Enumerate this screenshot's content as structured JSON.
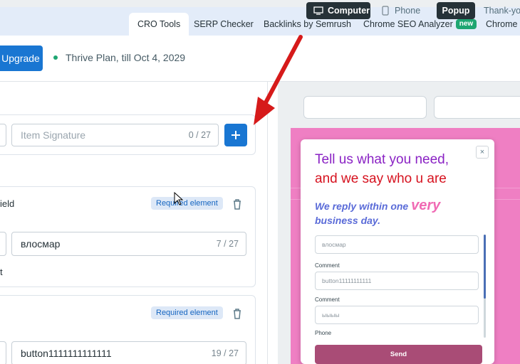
{
  "tabs": [
    {
      "label": "CRO Tools",
      "active": true
    },
    {
      "label": "SERP Checker"
    },
    {
      "label": "Backlinks by Semrush"
    },
    {
      "label": "Chrome SEO Analyzer",
      "badge": "new"
    },
    {
      "label": "Chrome U"
    }
  ],
  "plan": {
    "upgrade_label": "Upgrade",
    "text": "Thrive Plan, till Oct 4, 2029",
    "status_color": "#1ea672"
  },
  "editor": {
    "signature": {
      "placeholder": "Item Signature",
      "counter": "0 / 27"
    },
    "element1": {
      "title_fragment": "ield",
      "chip": "Required element",
      "value": "влосмар",
      "counter": "7 / 27",
      "below_fragment": "t"
    },
    "element2": {
      "chip": "Required element",
      "value": "button1111111111111",
      "counter": "19 / 27"
    }
  },
  "preview": {
    "modes": [
      {
        "label": "Computer",
        "icon": "monitor-icon",
        "active": true
      },
      {
        "label": "Phone",
        "icon": "phone-icon"
      }
    ],
    "views": [
      {
        "label": "Popup",
        "active": true
      },
      {
        "label": "Thank-yo"
      }
    ],
    "background_color": "#ef7fc3",
    "popup": {
      "close": "×",
      "heading_line1": "Tell us what you need,",
      "heading_line2": "and we say who u are",
      "sub_before": "We reply within one",
      "sub_emph": "very",
      "sub_line2": "business day.",
      "fields": [
        {
          "placeholder": "влосмар",
          "label": "Comment"
        },
        {
          "placeholder": "button11111111111",
          "label": "Comment"
        },
        {
          "placeholder": "ыыыы",
          "label": "Phone"
        }
      ],
      "send_label": "Send"
    }
  }
}
